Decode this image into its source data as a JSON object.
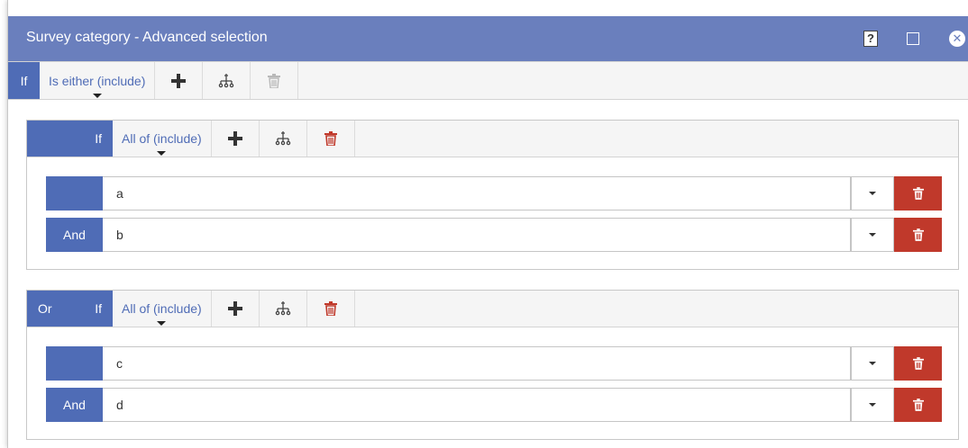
{
  "dialog": {
    "title": "Survey category - Advanced selection",
    "icons": [
      "help-icon",
      "maximize-icon",
      "close-icon"
    ]
  },
  "top_rule": {
    "if_label": "If",
    "operator": "Is either (include)"
  },
  "groups": [
    {
      "prefix": "",
      "if_label": "If",
      "operator": "All of (include)",
      "rows": [
        {
          "conj": "",
          "value": "a"
        },
        {
          "conj": "And",
          "value": "b"
        }
      ]
    },
    {
      "prefix": "Or",
      "if_label": "If",
      "operator": "All of (include)",
      "rows": [
        {
          "conj": "",
          "value": "c"
        },
        {
          "conj": "And",
          "value": "d"
        }
      ]
    }
  ],
  "colors": {
    "titlebar": "#6a7fbd",
    "accent": "#4f6cb6",
    "delete": "#c0392b"
  }
}
